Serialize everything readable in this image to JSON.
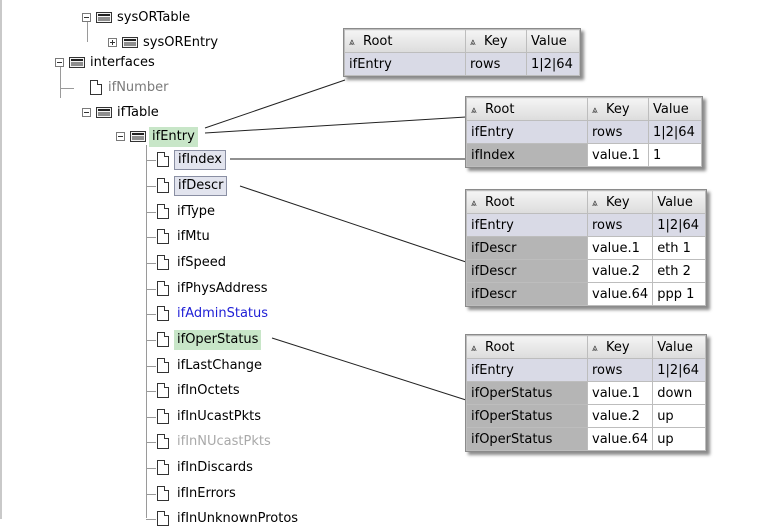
{
  "tree": [
    {
      "label": "sysORTable",
      "icon": "folder-icon",
      "expander": "minus",
      "style": "normal"
    },
    {
      "label": "sysOREntry",
      "icon": "folder-icon",
      "expander": "plus",
      "style": "normal"
    },
    {
      "label": "interfaces",
      "icon": "folder-icon",
      "expander": "minus",
      "style": "normal"
    },
    {
      "label": "ifNumber",
      "icon": "document-icon",
      "style": "normal"
    },
    {
      "label": "ifTable",
      "icon": "folder-icon",
      "expander": "minus",
      "style": "normal"
    },
    {
      "label": "ifEntry",
      "icon": "folder-icon",
      "expander": "minus",
      "style": "highlight-green"
    },
    {
      "label": "ifIndex",
      "icon": "document-icon",
      "style": "highlight-box"
    },
    {
      "label": "ifDescr",
      "icon": "document-icon",
      "style": "highlight-box"
    },
    {
      "label": "ifType",
      "icon": "document-icon",
      "style": "normal"
    },
    {
      "label": "ifMtu",
      "icon": "document-icon",
      "style": "normal"
    },
    {
      "label": "ifSpeed",
      "icon": "document-icon",
      "style": "normal"
    },
    {
      "label": "ifPhysAddress",
      "icon": "document-icon",
      "style": "normal"
    },
    {
      "label": "ifAdminStatus",
      "icon": "document-icon",
      "style": "link-blue"
    },
    {
      "label": "ifOperStatus",
      "icon": "document-icon",
      "style": "highlight-green"
    },
    {
      "label": "ifLastChange",
      "icon": "document-icon",
      "style": "normal"
    },
    {
      "label": "ifInOctets",
      "icon": "document-icon",
      "style": "normal"
    },
    {
      "label": "ifInUcastPkts",
      "icon": "document-icon",
      "style": "normal"
    },
    {
      "label": "ifInNUcastPkts",
      "icon": "document-icon",
      "style": "greyed"
    },
    {
      "label": "ifInDiscards",
      "icon": "document-icon",
      "style": "normal"
    },
    {
      "label": "ifInErrors",
      "icon": "document-icon",
      "style": "normal"
    },
    {
      "label": "ifInUnknownProtos",
      "icon": "document-icon",
      "style": "normal"
    }
  ],
  "popups": [
    {
      "headers": {
        "root": "Root",
        "key": "Key",
        "value": "Value"
      },
      "rows": [
        {
          "root": "ifEntry",
          "key": "rows",
          "value": "1|2|64"
        }
      ]
    },
    {
      "headers": {
        "root": "Root",
        "key": "Key",
        "value": "Value"
      },
      "rows": [
        {
          "root": "ifEntry",
          "key": "rows",
          "value": "1|2|64"
        },
        {
          "root": "ifIndex",
          "key": "value.1",
          "value": "1"
        }
      ]
    },
    {
      "headers": {
        "root": "Root",
        "key": "Key",
        "value": "Value"
      },
      "rows": [
        {
          "root": "ifEntry",
          "key": "rows",
          "value": "1|2|64"
        },
        {
          "root": "ifDescr",
          "key": "value.1",
          "value": "eth 1"
        },
        {
          "root": "ifDescr",
          "key": "value.2",
          "value": "eth 2"
        },
        {
          "root": "ifDescr",
          "key": "value.64",
          "value": "ppp 1"
        }
      ]
    },
    {
      "headers": {
        "root": "Root",
        "key": "Key",
        "value": "Value"
      },
      "rows": [
        {
          "root": "ifEntry",
          "key": "rows",
          "value": "1|2|64"
        },
        {
          "root": "ifOperStatus",
          "key": "value.1",
          "value": "down"
        },
        {
          "root": "ifOperStatus",
          "key": "value.2",
          "value": "up"
        },
        {
          "root": "ifOperStatus",
          "key": "value.64",
          "value": "up"
        }
      ]
    }
  ],
  "colors": {
    "highlight_green": "#c8e6c8",
    "selected_box": "#e2e4ee",
    "link_blue": "#1f1fd6",
    "table_name_cell": "#c9cad6"
  }
}
